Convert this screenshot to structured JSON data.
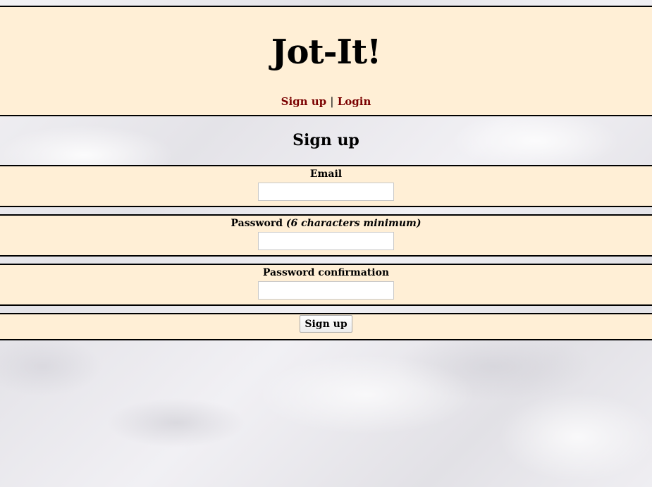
{
  "header": {
    "title": "Jot-It!",
    "nav": {
      "signup_label": "Sign up",
      "separator": "|",
      "login_label": "Login"
    }
  },
  "page": {
    "heading": "Sign up"
  },
  "form": {
    "email": {
      "label": "Email",
      "value": ""
    },
    "password": {
      "label": "Password",
      "hint": "(6 characters minimum)",
      "value": ""
    },
    "password_confirmation": {
      "label": "Password confirmation",
      "value": ""
    },
    "submit_label": "Sign up"
  },
  "colors": {
    "band_background": "#ffefd6",
    "link": "#7a0000",
    "border": "#000000"
  }
}
